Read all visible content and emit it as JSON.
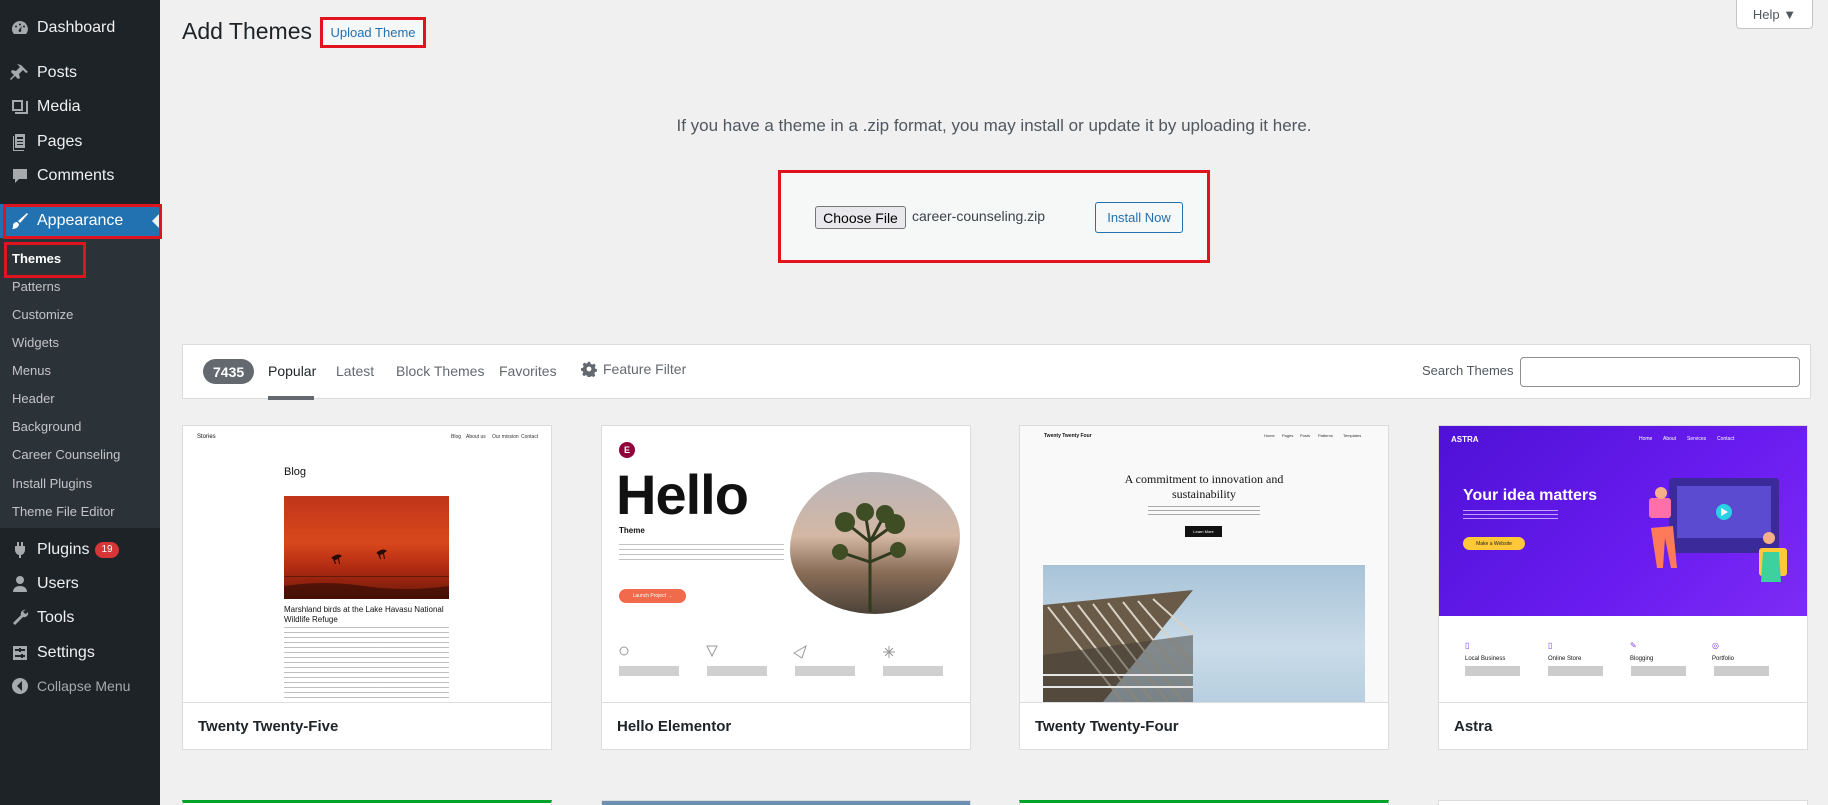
{
  "sidebar": {
    "items": [
      {
        "label": "Dashboard",
        "icon": "dashboard-icon"
      },
      {
        "label": "Posts",
        "icon": "pin-icon"
      },
      {
        "label": "Media",
        "icon": "media-icon"
      },
      {
        "label": "Pages",
        "icon": "pages-icon"
      },
      {
        "label": "Comments",
        "icon": "comment-icon"
      },
      {
        "label": "Appearance",
        "icon": "paintbrush-icon"
      },
      {
        "label": "Plugins",
        "icon": "plug-icon",
        "badge": "19"
      },
      {
        "label": "Users",
        "icon": "user-icon"
      },
      {
        "label": "Tools",
        "icon": "wrench-icon"
      },
      {
        "label": "Settings",
        "icon": "settings-icon"
      },
      {
        "label": "Collapse Menu",
        "icon": "collapse-icon"
      }
    ],
    "submenu": [
      "Themes",
      "Patterns",
      "Customize",
      "Widgets",
      "Menus",
      "Header",
      "Background",
      "Career Counseling",
      "Install Plugins",
      "Theme File Editor"
    ]
  },
  "header": {
    "title": "Add Themes",
    "upload_label": "Upload Theme",
    "help_label": "Help ▼"
  },
  "upload": {
    "description": "If you have a theme in a .zip format, you may install or update it by uploading it here.",
    "choose_file_label": "Choose File",
    "file_name": "career-counseling.zip",
    "install_label": "Install Now"
  },
  "filter": {
    "count": "7435",
    "tabs": [
      "Popular",
      "Latest",
      "Block Themes",
      "Favorites"
    ],
    "feature_filter": "Feature Filter",
    "search_label": "Search Themes",
    "search_value": ""
  },
  "themes": [
    {
      "name": "Twenty Twenty-Five",
      "preview": {
        "site": "Stories",
        "nav": [
          "Blog",
          "About us",
          "Our mission",
          "Contact"
        ],
        "heading": "Blog",
        "caption": "Marshland birds at the Lake Havasu National Wildlife Refuge"
      }
    },
    {
      "name": "Hello Elementor",
      "preview": {
        "logo": "E",
        "heading": "Hello",
        "subheading": "Theme",
        "button": "Launch Project →"
      }
    },
    {
      "name": "Twenty Twenty-Four",
      "preview": {
        "site": "Twenty Twenty Four",
        "nav": [
          "Home",
          "Pages",
          "Posts",
          "Patterns",
          "Templates"
        ],
        "heading": "A commitment to innovation and sustainability",
        "button": "Learn More"
      }
    },
    {
      "name": "Astra",
      "preview": {
        "logo": "ASTRA",
        "nav": [
          "Home",
          "About",
          "Services",
          "Contact"
        ],
        "heading": "Your idea matters",
        "button": "Make a Website",
        "features": [
          "Local Business",
          "Online Store",
          "Blogging",
          "Portfolio"
        ]
      }
    }
  ],
  "colors": {
    "sidebar": "#1d2327",
    "accent": "#2271b1",
    "highlight": "#e0141e",
    "badge": "#d63638",
    "astra_purple": "#5b18e6"
  }
}
